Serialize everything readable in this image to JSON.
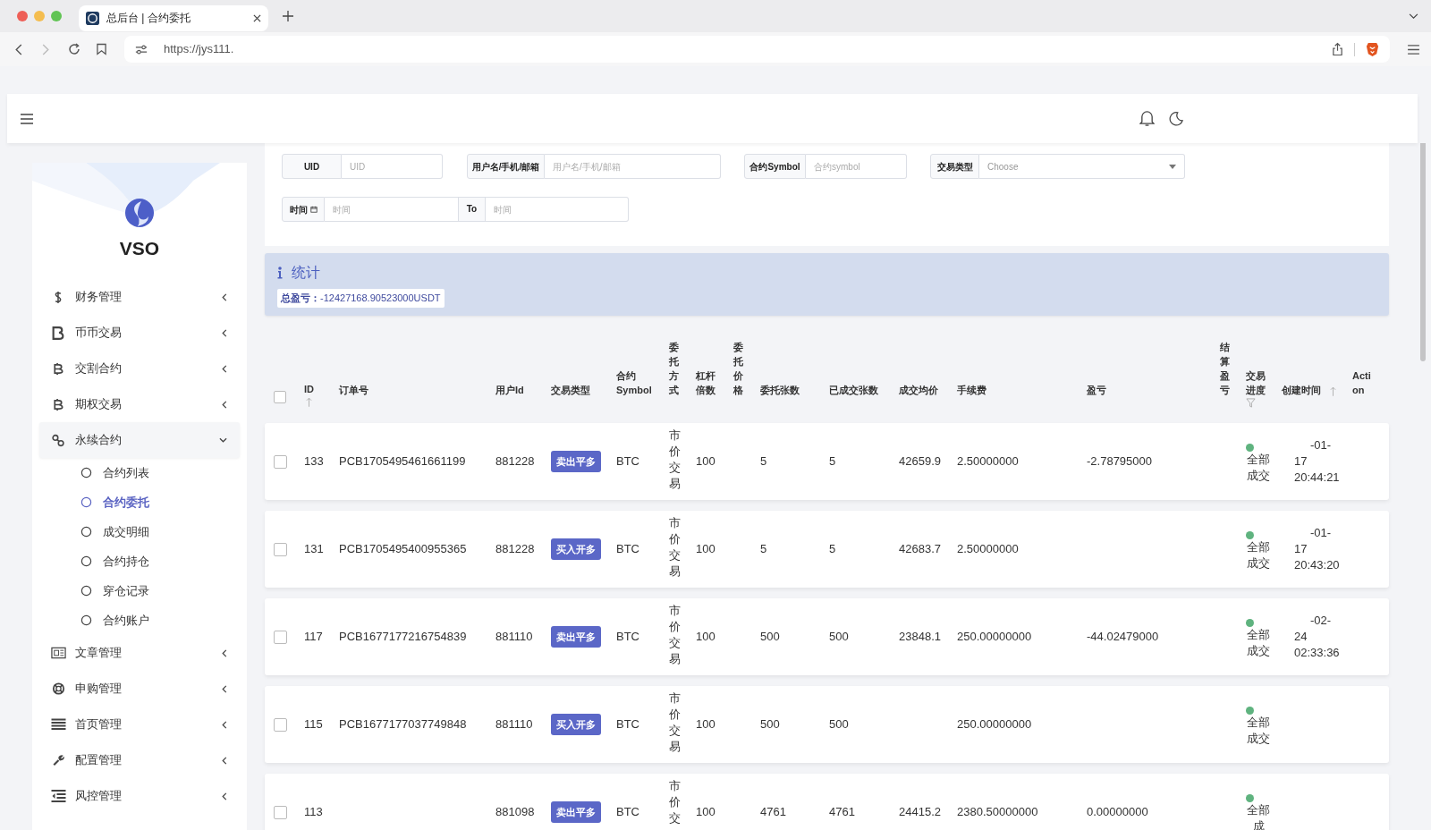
{
  "browser": {
    "tab_title": "总后台 | 合约委托",
    "url": "https://jys111."
  },
  "sidebar": {
    "brand": "VSO",
    "items": [
      {
        "label": "财务管理",
        "expanded": false
      },
      {
        "label": "币币交易",
        "expanded": false
      },
      {
        "label": "交割合约",
        "expanded": false
      },
      {
        "label": "期权交易",
        "expanded": false
      },
      {
        "label": "永续合约",
        "expanded": true,
        "children": [
          {
            "label": "合约列表",
            "selected": false
          },
          {
            "label": "合约委托",
            "selected": true
          },
          {
            "label": "成交明细",
            "selected": false
          },
          {
            "label": "合约持仓",
            "selected": false
          },
          {
            "label": "穿仓记录",
            "selected": false
          },
          {
            "label": "合约账户",
            "selected": false
          }
        ]
      },
      {
        "label": "文章管理",
        "expanded": false
      },
      {
        "label": "申购管理",
        "expanded": false
      },
      {
        "label": "首页管理",
        "expanded": false
      },
      {
        "label": "配置管理",
        "expanded": false
      },
      {
        "label": "风控管理",
        "expanded": false
      }
    ]
  },
  "filters": [
    {
      "kind": "text",
      "label": "UID",
      "placeholder": "UID"
    },
    {
      "kind": "text",
      "label": "用户名/手机/邮箱",
      "placeholder": "用户名/手机/邮箱"
    },
    {
      "kind": "text",
      "label": "合约Symbol",
      "placeholder": "合约symbol"
    },
    {
      "kind": "select",
      "label": "交易类型",
      "placeholder": "Choose"
    }
  ],
  "time_range": {
    "label": "时间",
    "from_placeholder": "时间",
    "to_label": "To",
    "to_placeholder": "时间"
  },
  "stats": {
    "title": "统计",
    "total": "**总盈亏：**-12427168.90523000USDT"
  },
  "table": {
    "select_all": {
      "checked": false
    },
    "columns": [
      {
        "label": "ID",
        "sorted": true
      },
      {
        "label": "订单号"
      },
      {
        "label": "用户Id"
      },
      {
        "label": "交易类型"
      },
      {
        "label": "合约 Symbol"
      },
      {
        "label": "委托方式"
      },
      {
        "label": "杠杆倍数"
      },
      {
        "label": "委托价格"
      },
      {
        "label": "委托张数"
      },
      {
        "label": "已成交张数"
      },
      {
        "label": "成交均价"
      },
      {
        "label": "手续费"
      },
      {
        "label": "盈亏"
      },
      {
        "label": "结算盈亏"
      },
      {
        "label": "交易进度",
        "filter": true
      },
      {
        "label": "创建时间",
        "sorted": true
      },
      {
        "label": "Action"
      }
    ],
    "rows": [
      {
        "checked": false,
        "id": "133",
        "order_no": "PCB1705495461661199",
        "user_id": "881228",
        "type": "卖出平多",
        "symbol": "BTC",
        "method": "市价交易",
        "leverage": "100",
        "qty": "5",
        "filled": "5",
        "avg_price": "42659.9",
        "fee": "2.50000000",
        "pnl": "-2.78795000",
        "status": "全部成交",
        "color": "#5fb37f",
        "time": "-01-17 20:44:21"
      },
      {
        "checked": false,
        "id": "131",
        "order_no": "PCB1705495400955365",
        "user_id": "881228",
        "type": "买入开多",
        "symbol": "BTC",
        "method": "市价交易",
        "leverage": "100",
        "qty": "5",
        "filled": "5",
        "avg_price": "42683.7",
        "fee": "2.50000000",
        "status": "全部成交",
        "color": "#5fb37f",
        "time": "-01-17 20:43:20"
      },
      {
        "checked": false,
        "id": "117",
        "order_no": "PCB1677177216754839",
        "user_id": "881110",
        "type": "卖出平多",
        "symbol": "BTC",
        "method": "市价交易",
        "leverage": "100",
        "qty": "500",
        "filled": "500",
        "avg_price": "23848.1",
        "fee": "250.00000000",
        "pnl": "-44.02479000",
        "status": "全部成交",
        "color": "#5fb37f",
        "time": "-02-24 02:33:36"
      },
      {
        "checked": false,
        "id": "115",
        "order_no": "PCB1677177037749848",
        "user_id": "881110",
        "type": "买入开多",
        "symbol": "BTC",
        "method": "市价交易",
        "leverage": "100",
        "qty": "500",
        "filled": "500",
        "fee": "250.00000000",
        "status": "全部成交",
        "color": "#5fb37f"
      },
      {
        "checked": false,
        "id": "113",
        "user_id": "881098",
        "type": "卖出平多",
        "symbol": "BTC",
        "method": "市价交",
        "leverage": "100",
        "qty": "4761",
        "filled": "4761",
        "avg_price": "24415.2",
        "fee": "2380.50000000",
        "pnl": "0.00000000",
        "status": "全部成",
        "color": "#5fb37f"
      }
    ]
  }
}
